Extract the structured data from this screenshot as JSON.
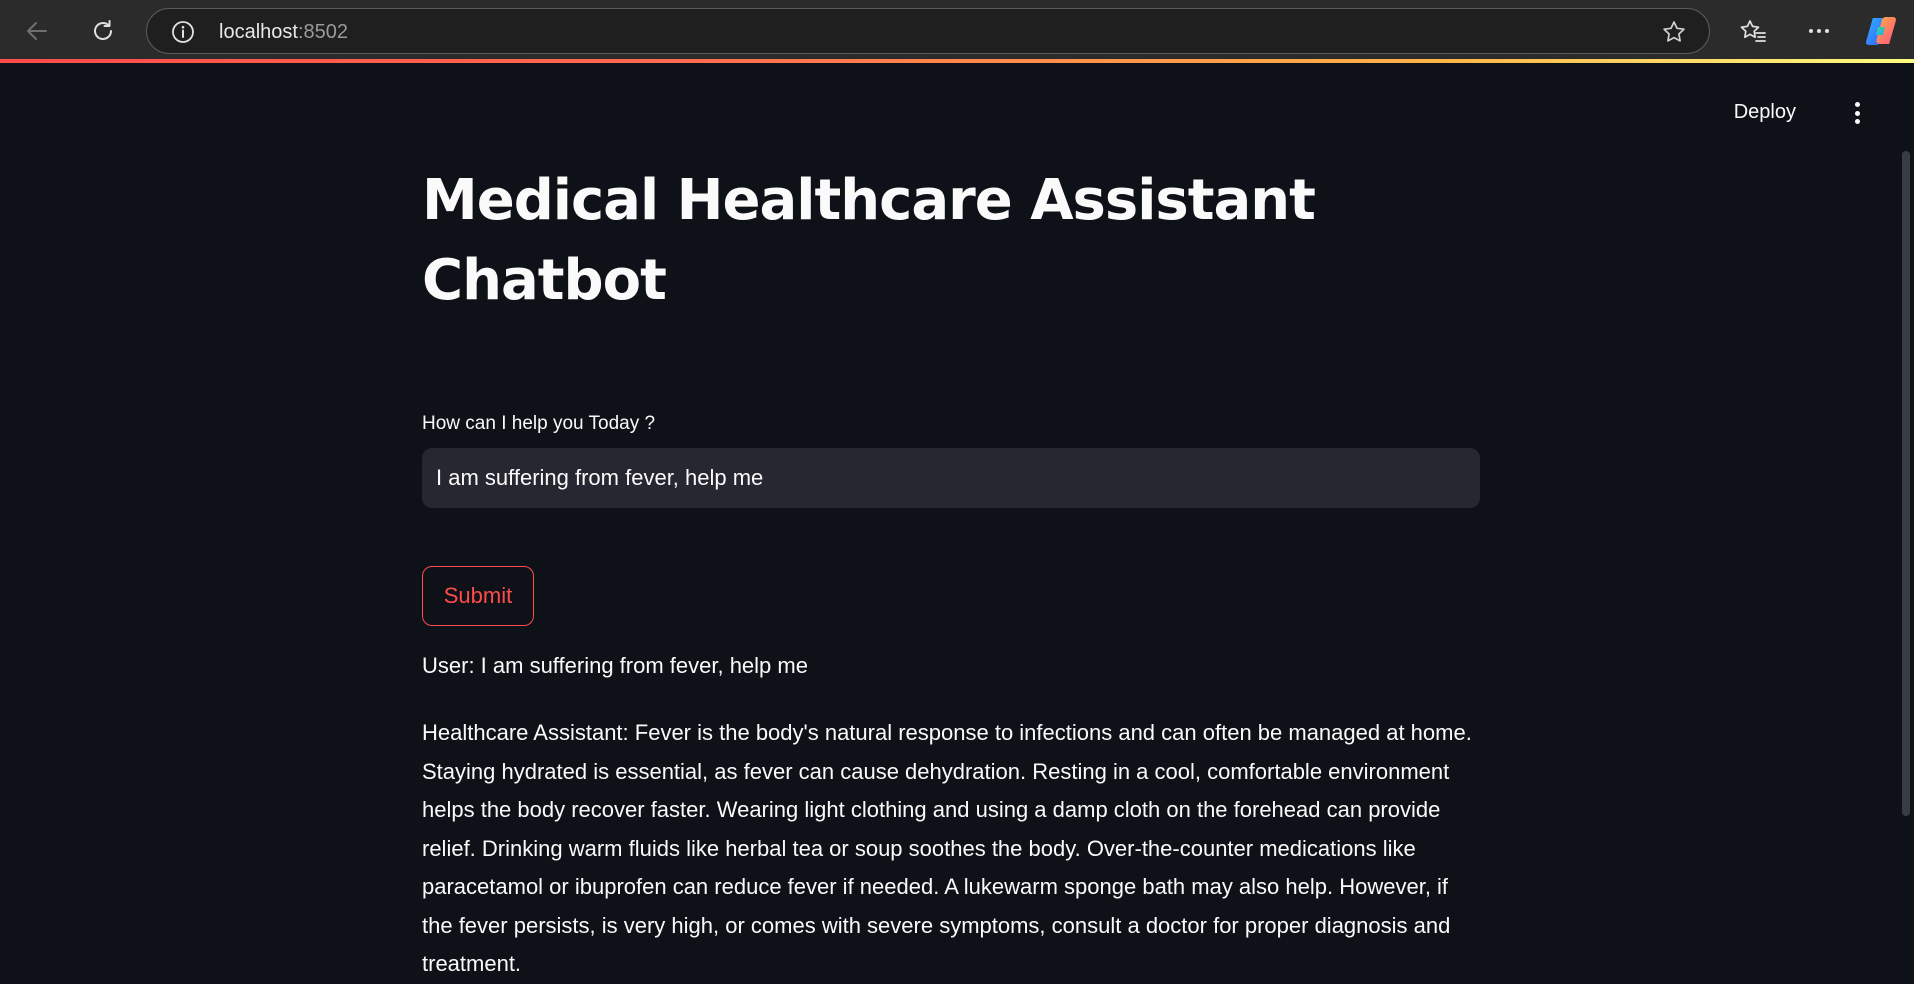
{
  "browser": {
    "url_host": "localhost",
    "url_port": ":8502"
  },
  "app": {
    "deploy_label": "Deploy",
    "title": "Medical Healthcare Assistant Chatbot",
    "input_label": "How can I help you Today ?",
    "input_value": "I am suffering from fever, help me",
    "submit_label": "Submit",
    "user_message": "User: I am suffering from fever, help me",
    "assistant_message": "Healthcare Assistant: Fever is the body's natural response to infections and can often be managed at home. Staying hydrated is essential, as fever can cause dehydration. Resting in a cool, comfortable environment helps the body recover faster. Wearing light clothing and using a damp cloth on the forehead can provide relief. Drinking warm fluids like herbal tea or soup soothes the body. Over-the-counter medications like paracetamol or ibuprofen can reduce fever if needed. A lukewarm sponge bath may also help. However, if the fever persists, is very high, or comes with severe symptoms, consult a doctor for proper diagnosis and treatment."
  },
  "colors": {
    "background": "#0e1117",
    "input_bg": "#262730",
    "accent": "#ff4b4b",
    "text": "#fafafa"
  },
  "icons": [
    "back-arrow-icon",
    "reload-icon",
    "info-icon",
    "star-icon",
    "favorites-icon",
    "more-icon",
    "copilot-icon",
    "kebab-menu-icon"
  ]
}
